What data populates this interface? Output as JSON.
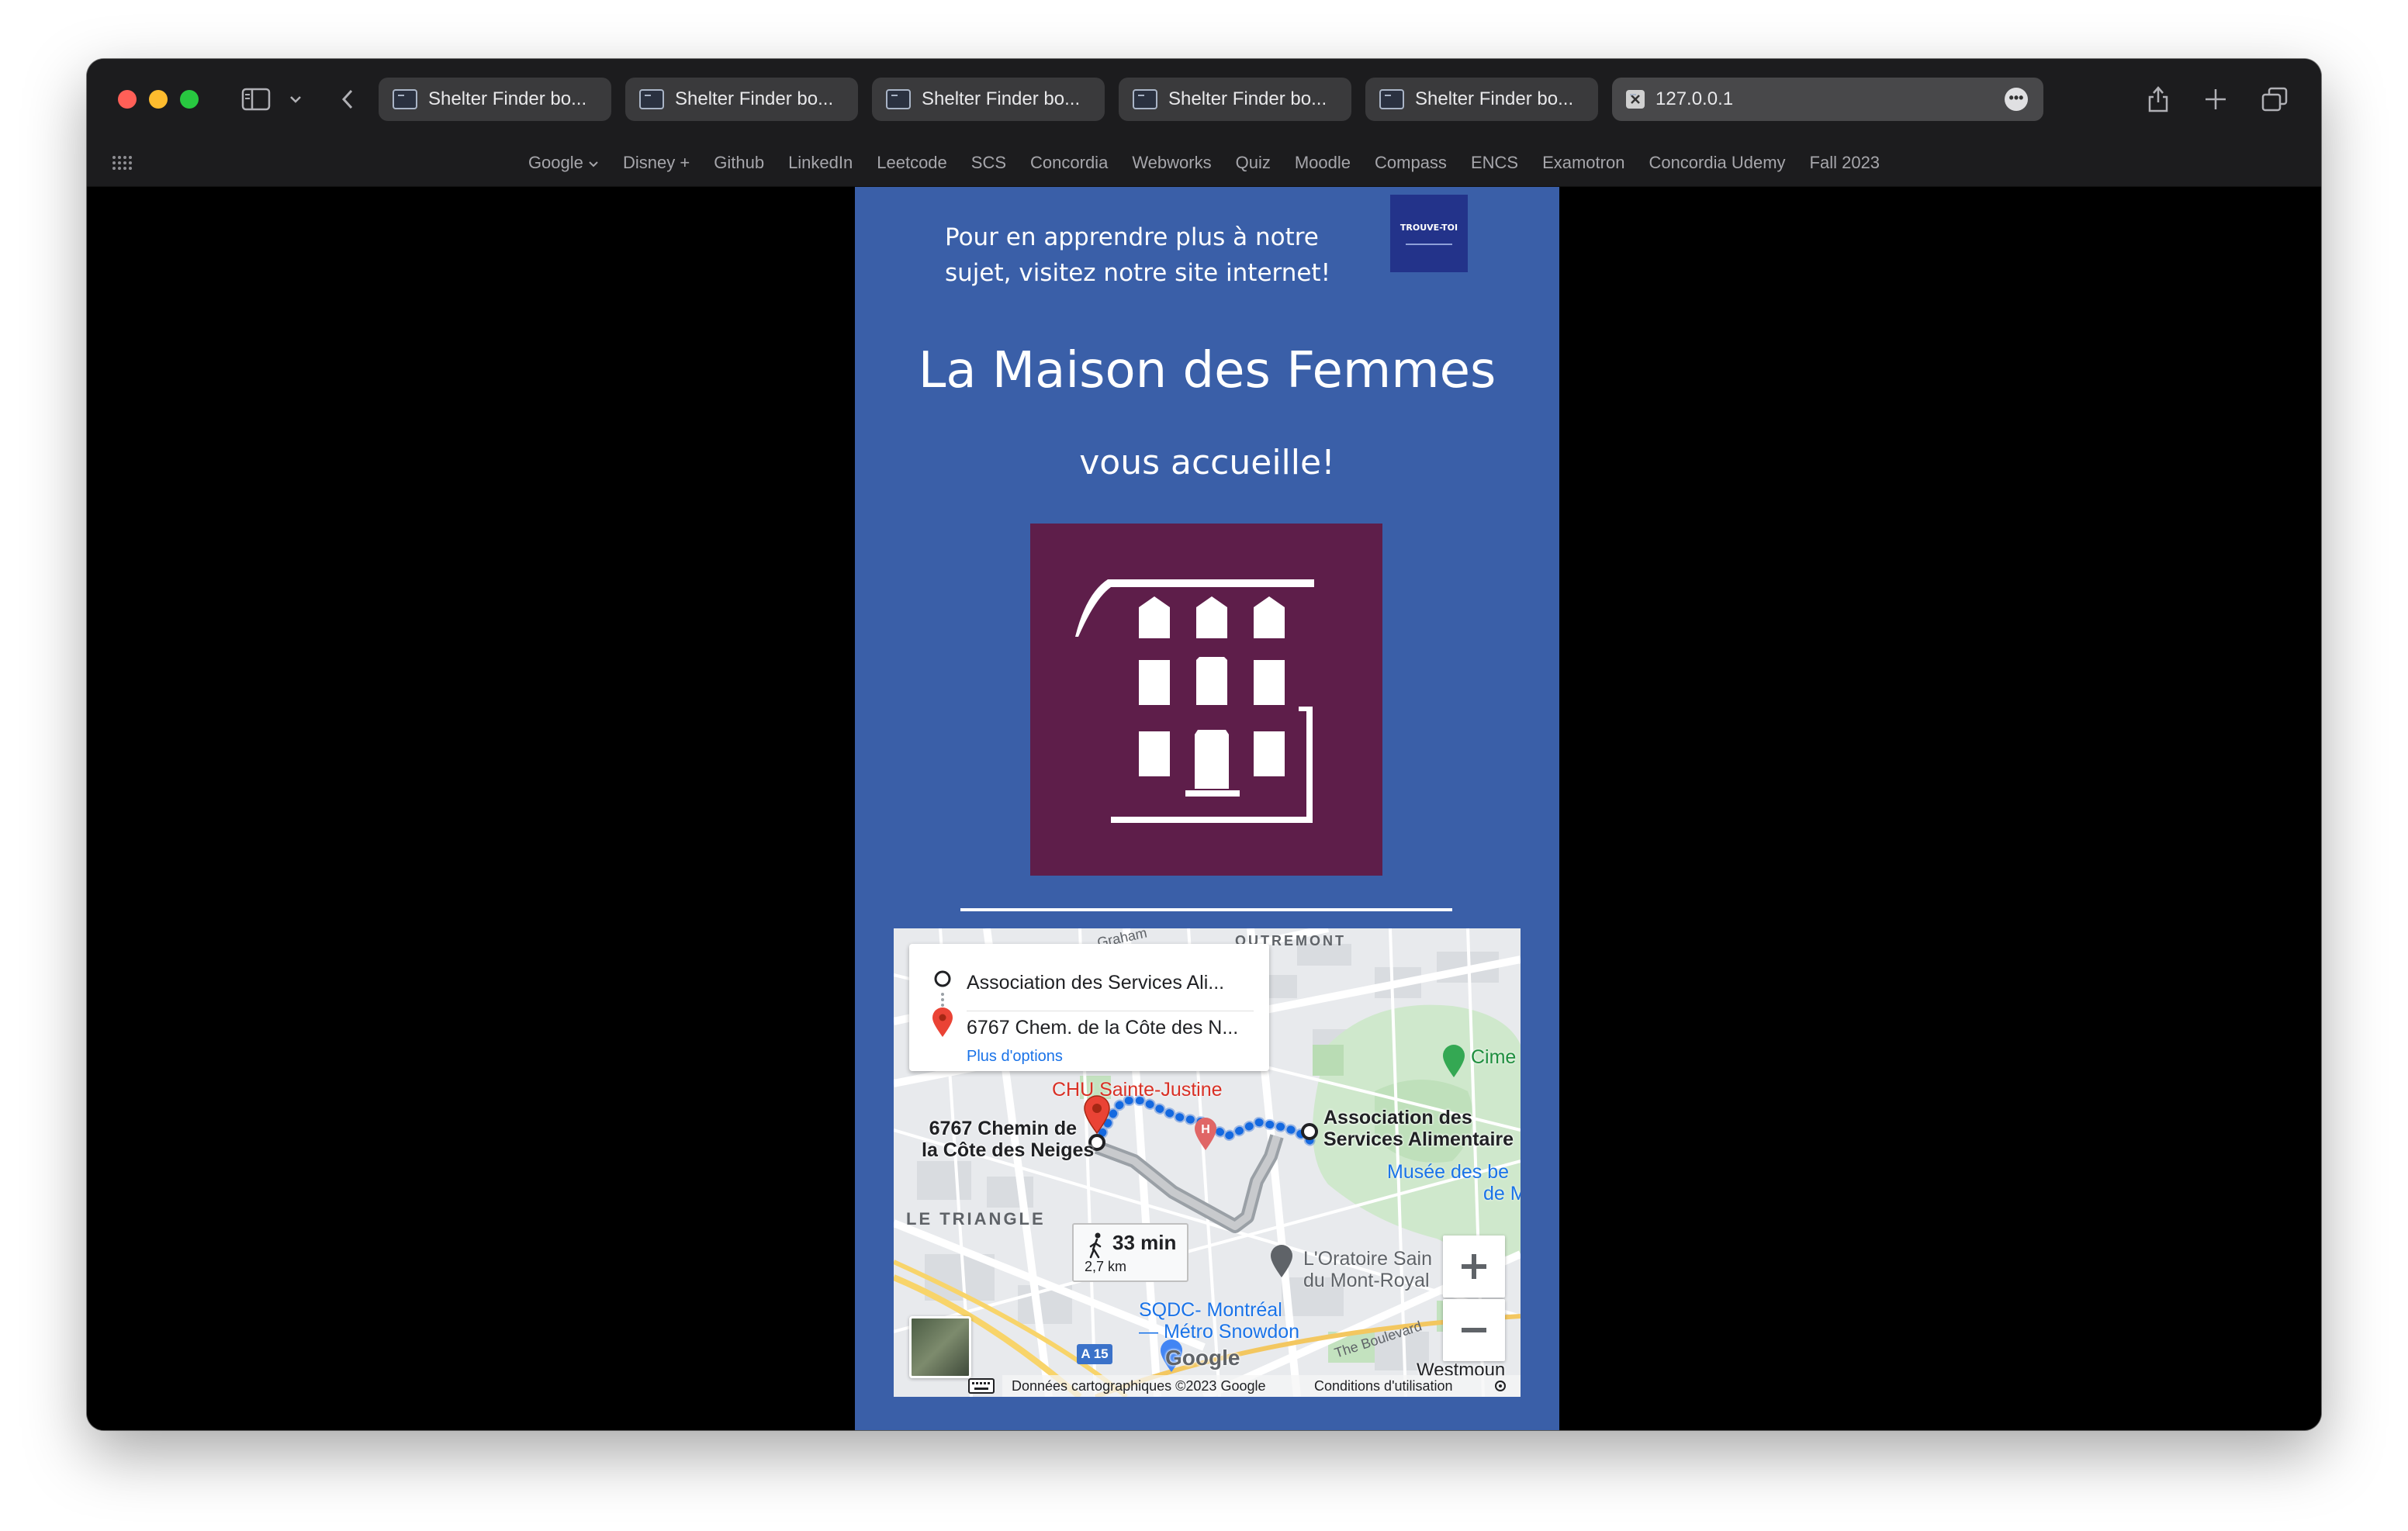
{
  "browser": {
    "tabs": [
      {
        "label": "Shelter Finder bo..."
      },
      {
        "label": "Shelter Finder bo..."
      },
      {
        "label": "Shelter Finder bo..."
      },
      {
        "label": "Shelter Finder bo..."
      },
      {
        "label": "Shelter Finder bo..."
      }
    ],
    "active_tab": {
      "label": "127.0.0.1"
    },
    "bookmarks": [
      "Google",
      "Disney +",
      "Github",
      "LinkedIn",
      "Leetcode",
      "SCS",
      "Concordia",
      "Webworks",
      "Quiz",
      "Moodle",
      "Compass",
      "ENCS",
      "Examotron",
      "Concordia Udemy",
      "Fall 2023"
    ]
  },
  "page": {
    "promo_text": "Pour en apprendre plus à notre sujet, visitez notre site internet!",
    "promo_logo_text": "TROUVE-TOI",
    "shelter_name": "La Maison des Femmes",
    "welcome": "vous accueille!",
    "colors": {
      "page_bg": "#3a5fa8",
      "logo_bg": "#5e1e4a",
      "promo_logo_bg": "#23338a"
    }
  },
  "map": {
    "origin": "Association des Services Ali...",
    "destination": "6767 Chem. de la Côte des N...",
    "more_options": "Plus d'options",
    "labels": {
      "dest_line1": "6767 Chemin de",
      "dest_line2": "la Côte des Neiges",
      "orig_line1": "Association des",
      "orig_line2": "Services Alimentaire",
      "hospital": "CHU Sainte-Justine",
      "museum_line1": "Musée des be",
      "museum_line2": "de M",
      "oratoire_line1": "L'Oratoire Sain",
      "oratoire_line2": "du Mont-Royal",
      "sqdc_line1": "SQDC- Montréal",
      "sqdc_line2": "— Métro Snowdon",
      "area": "LE TRIANGLE",
      "outremont": "OUTREMONT",
      "cime": "Cime",
      "westmount": "Westmoun",
      "graham": "Graham",
      "boulevard": "The Boulevard",
      "highway": "A 15"
    },
    "eta_time": "33 min",
    "eta_distance": "2,7 km",
    "attribution": "Données cartographiques ©2023 Google",
    "terms": "Conditions d'utilisation",
    "google": "Google"
  }
}
